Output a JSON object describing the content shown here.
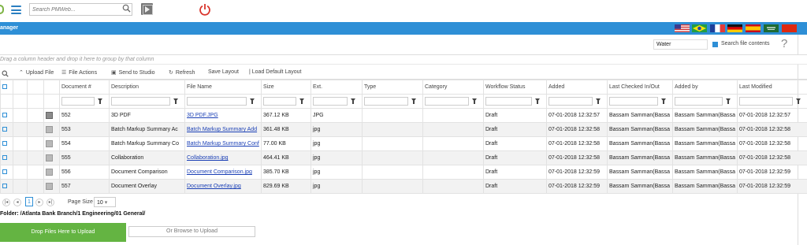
{
  "search": {
    "placeholder": "Search PMWeb..."
  },
  "header": {
    "title": "anager"
  },
  "filter": {
    "keyword": "Water",
    "search_file_contents_label": "Search file contents",
    "search_file_contents_checked": true
  },
  "help_label": "?",
  "group_hint": "Drag a column header and drop it here to group by that column",
  "toolbar": {
    "upload": "Upload File",
    "file_actions": "File Actions",
    "send_to_studio": "Send to Studio",
    "refresh": "Refresh",
    "save_layout": "Save Layout",
    "load_default_layout": "Load Default Layout"
  },
  "columns": [
    "Document #",
    "Description",
    "File Name",
    "Size",
    "Ext.",
    "Type",
    "Category",
    "Workflow Status",
    "Added",
    "Last Checked In/Out",
    "Added by",
    "Last Modified"
  ],
  "rows": [
    {
      "doc": "552",
      "desc": "3D PDF",
      "file": "3D PDF.JPG",
      "size": "367.12 KB",
      "ext": "JPG",
      "type": "",
      "category": "",
      "status": "Draft",
      "added": "07-01-2018 12:32:57",
      "checked": "Bassam Samman(Bassa",
      "added_by": "Bassam Samman(Bassa",
      "modified": "07-01-2018 12:32:57"
    },
    {
      "doc": "553",
      "desc": "Batch Markup Summary Ac",
      "file": "Batch Markup Summary Add",
      "size": "361.48 KB",
      "ext": "jpg",
      "type": "",
      "category": "",
      "status": "Draft",
      "added": "07-01-2018 12:32:58",
      "checked": "Bassam Samman(Bassa",
      "added_by": "Bassam Samman(Bassa",
      "modified": "07-01-2018 12:32:58"
    },
    {
      "doc": "554",
      "desc": "Batch Markup Summary Co",
      "file": "Batch Markup Summary Conf",
      "size": "77.00 KB",
      "ext": "jpg",
      "type": "",
      "category": "",
      "status": "Draft",
      "added": "07-01-2018 12:32:58",
      "checked": "Bassam Samman(Bassa",
      "added_by": "Bassam Samman(Bassa",
      "modified": "07-01-2018 12:32:58"
    },
    {
      "doc": "555",
      "desc": "Collaboration",
      "file": "Collaboration.jpg",
      "size": "464.41 KB",
      "ext": "jpg",
      "type": "",
      "category": "",
      "status": "Draft",
      "added": "07-01-2018 12:32:58",
      "checked": "Bassam Samman(Bassa",
      "added_by": "Bassam Samman(Bassa",
      "modified": "07-01-2018 12:32:58"
    },
    {
      "doc": "556",
      "desc": "Document Comparison",
      "file": "Document Comparison.jpg",
      "size": "385.70 KB",
      "ext": "jpg",
      "type": "",
      "category": "",
      "status": "Draft",
      "added": "07-01-2018 12:32:59",
      "checked": "Bassam Samman(Bassa",
      "added_by": "Bassam Samman(Bassa",
      "modified": "07-01-2018 12:32:59"
    },
    {
      "doc": "557",
      "desc": "Document Overlay",
      "file": "Document Overlay.jpg",
      "size": "829.69 KB",
      "ext": "jpg",
      "type": "",
      "category": "",
      "status": "Draft",
      "added": "07-01-2018 12:32:59",
      "checked": "Bassam Samman(Bassa",
      "added_by": "Bassam Samman(Bassa",
      "modified": "07-01-2018 12:32:59"
    }
  ],
  "pager": {
    "current_page": "1",
    "page_size_label": "Page Size",
    "page_size": "10"
  },
  "folder_path": "Folder: /Atlanta Bank Branch/1 Engineering/01 General/",
  "upload": {
    "drop_label": "Drop Files Here to Upload",
    "browse_label": "Or Browse to Upload"
  },
  "colors": {
    "header_blue": "#2e8fd6",
    "drop_green": "#64b442",
    "power_red": "#d9342b"
  }
}
